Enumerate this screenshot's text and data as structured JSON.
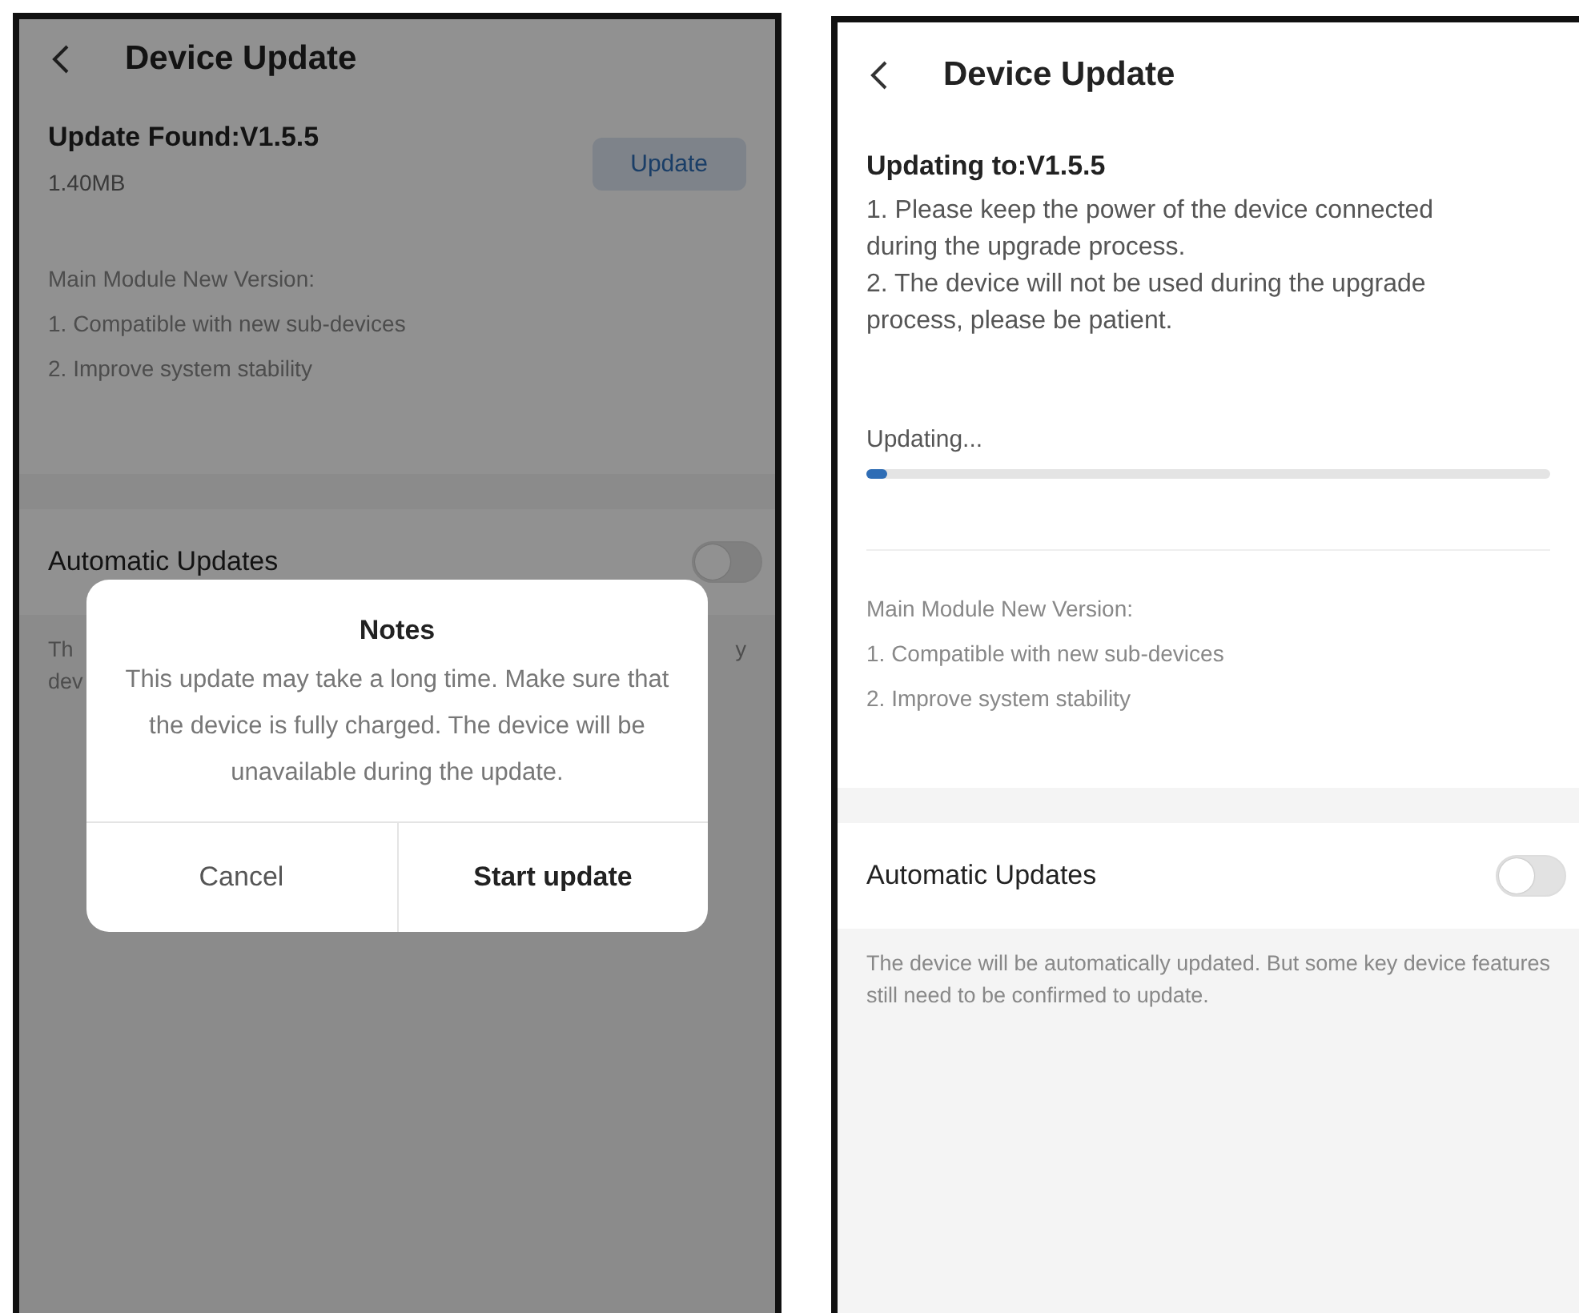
{
  "screens": [
    {
      "title": "Device Update",
      "header": {
        "heading": "Update Found:V1.5.5",
        "size": "1.40MB",
        "button": "Update"
      },
      "release_notes": {
        "heading": "Main Module New Version:",
        "items": [
          "1. Compatible with new sub-devices",
          "2. Improve system stability"
        ]
      },
      "auto_update": {
        "label": "Automatic Updates",
        "on": false,
        "hint_fragments": {
          "left": [
            "Th",
            "dev"
          ],
          "right": "y"
        }
      },
      "dialog": {
        "title": "Notes",
        "message": "This update may take a long time. Make sure that the device is fully charged. The device will be unavailable during the update.",
        "buttons": [
          {
            "label": "Cancel",
            "primary": false
          },
          {
            "label": "Start update",
            "primary": true
          }
        ]
      }
    },
    {
      "title": "Device Update",
      "header": {
        "heading": "Updating to:V1.5.5"
      },
      "instructions": [
        "1. Please keep the power of the device connected during the upgrade process.",
        "2. The device will not be used during the upgrade process, please be patient."
      ],
      "progress": {
        "label": "Updating...",
        "level": 0.03
      },
      "release_notes": {
        "heading": "Main Module New Version:",
        "items": [
          "1. Compatible with new sub-devices",
          "2. Improve system stability"
        ]
      },
      "auto_update": {
        "label": "Automatic Updates",
        "on": false,
        "hint": "The device will be automatically updated. But some key device features still need to be confirmed to update."
      }
    }
  ]
}
